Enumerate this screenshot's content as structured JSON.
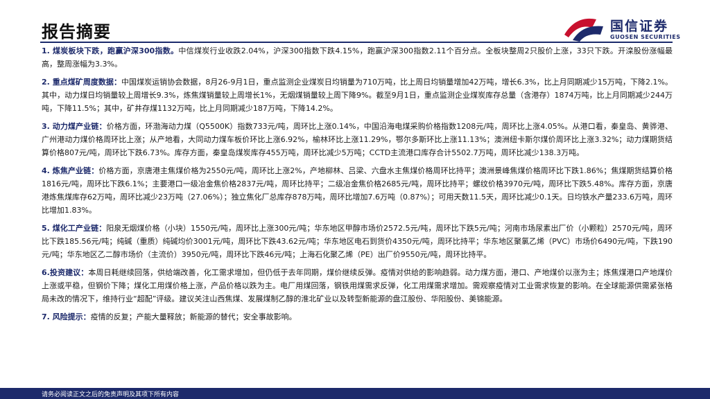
{
  "header": {
    "title": "报告摘要"
  },
  "logo": {
    "name_cn": "国信证券",
    "name_en": "GUOSEN SECURITIES"
  },
  "colors": {
    "brand_navy": "#1d2a6b",
    "brand_red": "#c8102e"
  },
  "paragraphs": [
    {
      "lead": "1. 煤炭板块下跌，跑赢沪深300指数。",
      "text": "中信煤炭行业收跌2.04%，沪深300指数下跌4.15%，跑赢沪深300指数2.11个百分点。全板块整周2只股价上涨，33只下跌。开滦股份涨幅最高，整周涨幅为3.3%。"
    },
    {
      "lead": "2. 重点煤矿周度数据：",
      "text": "中国煤炭运销协会数据，8月26-9月1日，重点监测企业煤炭日均销量为710万吨，比上周日均销量增加42万吨，增长6.3%，比上月同期减少15万吨，下降2.1%。其中，动力煤日均销量较上周增长9.3%，炼焦煤销量较上周增长1%，无烟煤销量较上周下降9%。截至9月1日，重点监测企业煤炭库存总量（含港存）1874万吨，比上月同期减少244万吨，下降11.5%；其中，矿井存煤1132万吨，比上月同期减少187万吨，下降14.2%。"
    },
    {
      "lead": "3. 动力煤产业链：",
      "text": "价格方面，环渤海动力煤（Q5500K）指数733元/吨，周环比上涨0.14%，中国沿海电煤采购价格指数1208元/吨，周环比上涨4.05%。从港口看，秦皇岛、黄骅港、广州港动力煤价格周环比上涨；从产地看，大同动力煤车板价环比上涨6.92%，榆林环比上涨11.29%，鄂尔多斯环比上涨11.13%；澳洲纽卡斯尔煤价周环比上涨3.32%；动力煤期货结算价格807元/吨，周环比下跌6.73%。库存方面，秦皇岛煤炭库存455万吨，周环比减少5万吨；CCTD主流港口库存合计5502.7万吨，周环比减少138.3万吨。"
    },
    {
      "lead": "4. 炼焦产业链：",
      "text": "价格方面，京唐港主焦煤价格为2550元/吨，周环比上涨2%，产地柳林、吕梁、六盘水主焦煤价格周环比持平；澳洲景峰焦煤价格周环比下跌1.86%；焦煤期货结算价格1816元/吨，周环比下跌6.1%；主要港口一级冶金焦价格2837元/吨，周环比持平；二级冶金焦价格2685元/吨，周环比持平；螺纹价格3970元/吨，周环比下跌5.48%。库存方面，京唐港炼焦煤库存62万吨，周环比减少23万吨（27.06%）；独立焦化厂总库存878万吨，周环比增加7.6万吨（0.87%）；可用天数11.5天，周环比减少0.1天。日均铁水产量233.6万吨，周环比增加1.83%。"
    },
    {
      "lead": "5. 煤化工产业链：",
      "text": "阳泉无烟煤价格（小块）1550元/吨，周环比上涨300元/吨；华东地区甲醇市场价2572.5元/吨，周环比下跌5元/吨；河南市场尿素出厂价（小颗粒）2570元/吨，周环比下跌185.56元/吨；纯碱（重质）纯碱均价3001元/吨，周环比下跌43.62元/吨；华东地区电石到货价4350元/吨，周环比持平；华东地区聚氯乙烯（PVC）市场价6490元/吨，下跌190元/吨；华东地区乙二醇市场价（主流价）3950元/吨，周环比下跌46元/吨；上海石化聚乙烯（PE）出厂价9550元/吨，周环比持平。"
    },
    {
      "lead": "6.投资建议：",
      "text": "本周日耗继续回落，供给端改善，化工需求增加，但仍低于去年同期，煤价继续反弹。疫情对供给的影响趋弱。动力煤方面，港口、产地煤价以涨为主；炼焦煤港口产地煤价上涨或平稳，但钢价下降；煤化工用煤价格上涨，产品价格以跌为主。电厂用煤回落，钢铁用煤需求反弹，化工用煤需求增加。需观察疫情对工业需求恢复的影响。在全球能源供需紧张格局未改的情况下，维持行业“超配”评级。建议关注山西焦煤、发展煤制乙醇的淮北矿业以及转型新能源的盘江股份、华阳股份、美锦能源。"
    },
    {
      "lead": "7. 风险提示：",
      "text": "疫情的反复；产能大量释放；新能源的替代；安全事故影响。"
    }
  ],
  "footer": {
    "disclaimer": "请务必阅读正文之后的免责声明及其项下所有内容"
  }
}
